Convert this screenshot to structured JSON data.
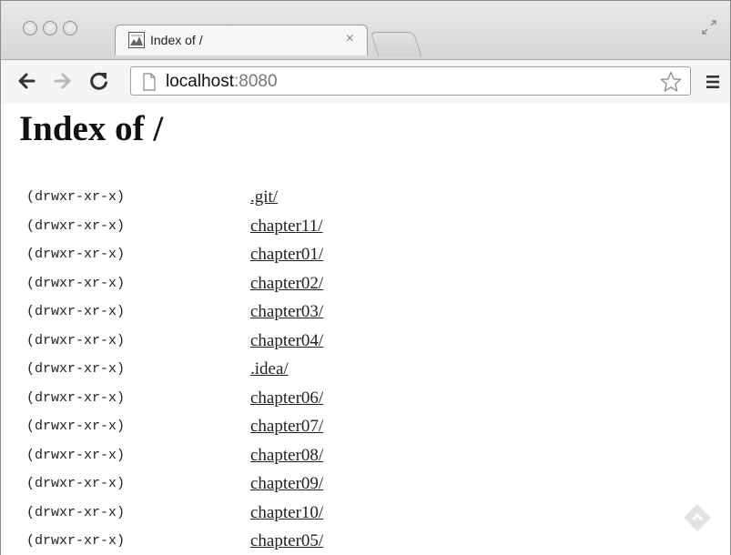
{
  "tab": {
    "title": "Index of /",
    "close": "×"
  },
  "omnibox": {
    "host": "localhost",
    "port": ":8080"
  },
  "page": {
    "heading": "Index of /"
  },
  "entries": [
    {
      "perm": "(drwxr-xr-x)",
      "name": ".git/"
    },
    {
      "perm": "(drwxr-xr-x)",
      "name": "chapter11/"
    },
    {
      "perm": "(drwxr-xr-x)",
      "name": "chapter01/"
    },
    {
      "perm": "(drwxr-xr-x)",
      "name": "chapter02/"
    },
    {
      "perm": "(drwxr-xr-x)",
      "name": "chapter03/"
    },
    {
      "perm": "(drwxr-xr-x)",
      "name": "chapter04/"
    },
    {
      "perm": "(drwxr-xr-x)",
      "name": ".idea/"
    },
    {
      "perm": "(drwxr-xr-x)",
      "name": "chapter06/"
    },
    {
      "perm": "(drwxr-xr-x)",
      "name": "chapter07/"
    },
    {
      "perm": "(drwxr-xr-x)",
      "name": "chapter08/"
    },
    {
      "perm": "(drwxr-xr-x)",
      "name": "chapter09/"
    },
    {
      "perm": "(drwxr-xr-x)",
      "name": "chapter10/"
    },
    {
      "perm": "(drwxr-xr-x)",
      "name": "chapter05/"
    }
  ],
  "icons": {
    "back": "back-arrow-icon",
    "forward": "forward-arrow-icon",
    "reload": "reload-icon",
    "page": "page-icon",
    "star": "bookmark-star-icon",
    "menu": "hamburger-menu-icon",
    "fullscreen": "fullscreen-icon",
    "favicon": "favicon-icon",
    "watermark": "watermark-icon"
  }
}
